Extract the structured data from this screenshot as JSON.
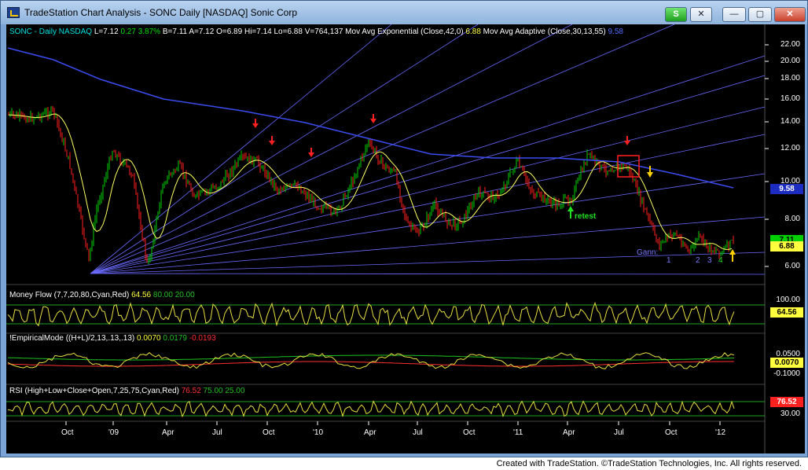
{
  "window": {
    "title": "TradeStation Chart Analysis - SONC Daily [NASDAQ] Sonic Corp",
    "symbol_button": "S",
    "close_small": "✕",
    "min": "—",
    "max": "▢",
    "close": "✕"
  },
  "header": {
    "symbol": "SONC - Daily",
    "exchange": "NASDAQ",
    "last": "L=7.12",
    "change": "0.27",
    "pct": "3.87%",
    "bid": "B=7.11",
    "ask": "A=7.12",
    "open": "O=6.89",
    "high": "Hi=7.14",
    "low": "Lo=6.88",
    "volume": "V=764,137",
    "ema_label": "Mov Avg Exponential (Close,42,0)",
    "ema_value": "6.88",
    "ama_label": "Mov Avg Adaptive (Close,30,13,55)",
    "ama_value": "9.58"
  },
  "price_axis": [
    "22.00",
    "20.00",
    "18.00",
    "16.00",
    "14.00",
    "12.00",
    "10.00",
    "8.00",
    "6.00"
  ],
  "price_badges": {
    "ama": "9.58",
    "last": "7.11",
    "ema": "6.88"
  },
  "annotations": {
    "retest": "retest",
    "gann": "Gann:",
    "counts": [
      "1",
      "2",
      "3",
      "4"
    ]
  },
  "money_flow": {
    "label": "Money Flow (7,7,20,80,Cyan,Red)",
    "value": "64.56",
    "upper": "80.00",
    "lower": "20.00",
    "axis": [
      "100.00"
    ],
    "badge": "64.56"
  },
  "empirical_mode": {
    "label": "!EmpiricalMode ((H+L)/2,13,.13,.13)",
    "v1": "0.0070",
    "v2": "0.0179",
    "v3": "-0.0193",
    "axis": [
      "0.0500",
      "-0.1000"
    ],
    "badge": "0.0070"
  },
  "rsi": {
    "label": "RSI (High+Low+Close+Open,7,25,75,Cyan,Red)",
    "v1": "76.52",
    "v2": "75.00",
    "v3": "25.00",
    "axis": [
      "30.00"
    ],
    "badge": "76.52"
  },
  "time_axis": [
    "Oct",
    "'09",
    "Apr",
    "Jul",
    "Oct",
    "'10",
    "Apr",
    "Jul",
    "Oct",
    "'11",
    "Apr",
    "Jul",
    "Oct",
    "'12"
  ],
  "footer": "Created with TradeStation. ©TradeStation Technologies, Inc. All rights reserved.",
  "colors": {
    "up": "#00d000",
    "down": "#ff2020",
    "ema": "#ffff60",
    "ama": "#3b4cf0",
    "gann": "#6a6aff"
  }
}
